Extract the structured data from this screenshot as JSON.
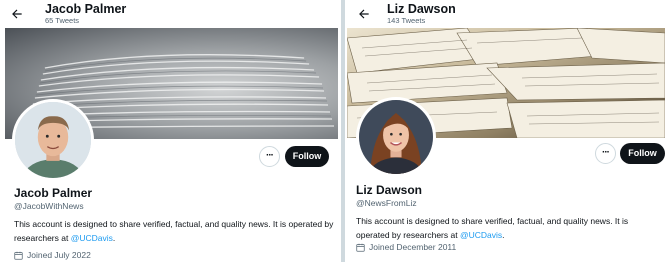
{
  "profiles": [
    {
      "header_name": "Jacob Palmer",
      "tweet_count": "65 Tweets",
      "display_name": "Jacob Palmer",
      "handle": "@JacobWithNews",
      "bio_text": "This account is designed to share verified, factual, and quality news. It is operated by researchers at ",
      "bio_mention": "@UCDavis",
      "bio_end": ".",
      "joined": "Joined July 2022",
      "follow_label": "Follow",
      "more_label": "···"
    },
    {
      "header_name": "Liz Dawson",
      "tweet_count": "143 Tweets",
      "display_name": "Liz Dawson",
      "handle": "@NewsFromLiz",
      "bio_text": "This account is designed to share verified, factual, and quality news. It is operated by researchers at ",
      "bio_mention": "@UCDavis",
      "bio_end": ".",
      "joined": "Joined December 2011",
      "follow_label": "Follow",
      "more_label": "···"
    }
  ],
  "icons": {
    "back": "back-arrow-icon",
    "more": "more-horizontal-icon",
    "calendar": "calendar-icon"
  },
  "colors": {
    "text": "#0f1419",
    "secondary": "#536471",
    "link": "#1d9bf0",
    "follow_bg": "#0f1419"
  }
}
